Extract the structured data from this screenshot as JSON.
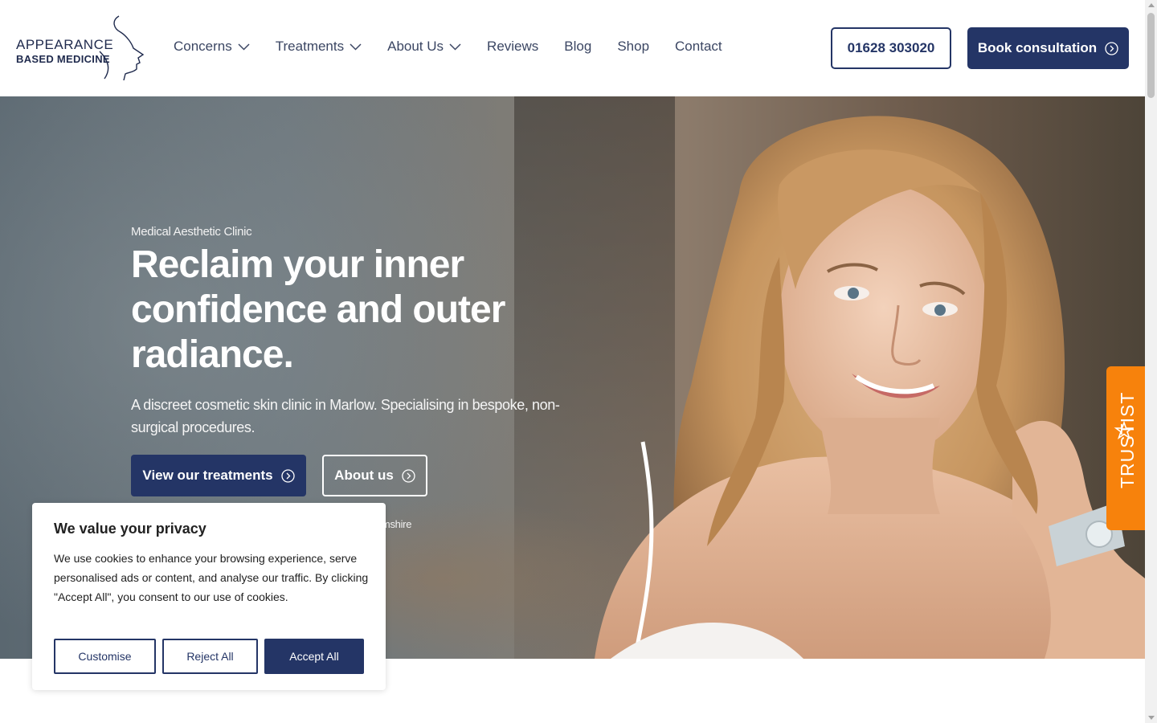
{
  "brand": {
    "line1": "APPEARANCE",
    "line2": "BASED MEDICINE"
  },
  "nav": {
    "items": [
      {
        "label": "Concerns",
        "has_dropdown": true
      },
      {
        "label": "Treatments",
        "has_dropdown": true
      },
      {
        "label": "About Us",
        "has_dropdown": true
      },
      {
        "label": "Reviews",
        "has_dropdown": false
      },
      {
        "label": "Blog",
        "has_dropdown": false
      },
      {
        "label": "Shop",
        "has_dropdown": false
      },
      {
        "label": "Contact",
        "has_dropdown": false
      }
    ],
    "phone": "01628 303020",
    "book": "Book consultation"
  },
  "hero": {
    "eyebrow": "Medical Aesthetic Clinic",
    "title": "Reclaim your inner confidence and outer radiance.",
    "subtitle": "A discreet cosmetic skin clinic in Marlow. Specialising in bespoke, non-surgical procedures.",
    "primary_button": "View our treatments",
    "secondary_button": "About us",
    "location_fragment": "amshire"
  },
  "trustist": {
    "label": "TRUSTIST"
  },
  "cookie": {
    "title": "We value your privacy",
    "body": "We use cookies to enhance your browsing experience, serve personalised ads or content, and analyse our traffic. By clicking \"Accept All\", you consent to our use of cookies.",
    "customise": "Customise",
    "reject": "Reject All",
    "accept": "Accept All"
  },
  "colors": {
    "navy": "#243566",
    "trustist_orange": "#f7820c",
    "white": "#ffffff"
  }
}
